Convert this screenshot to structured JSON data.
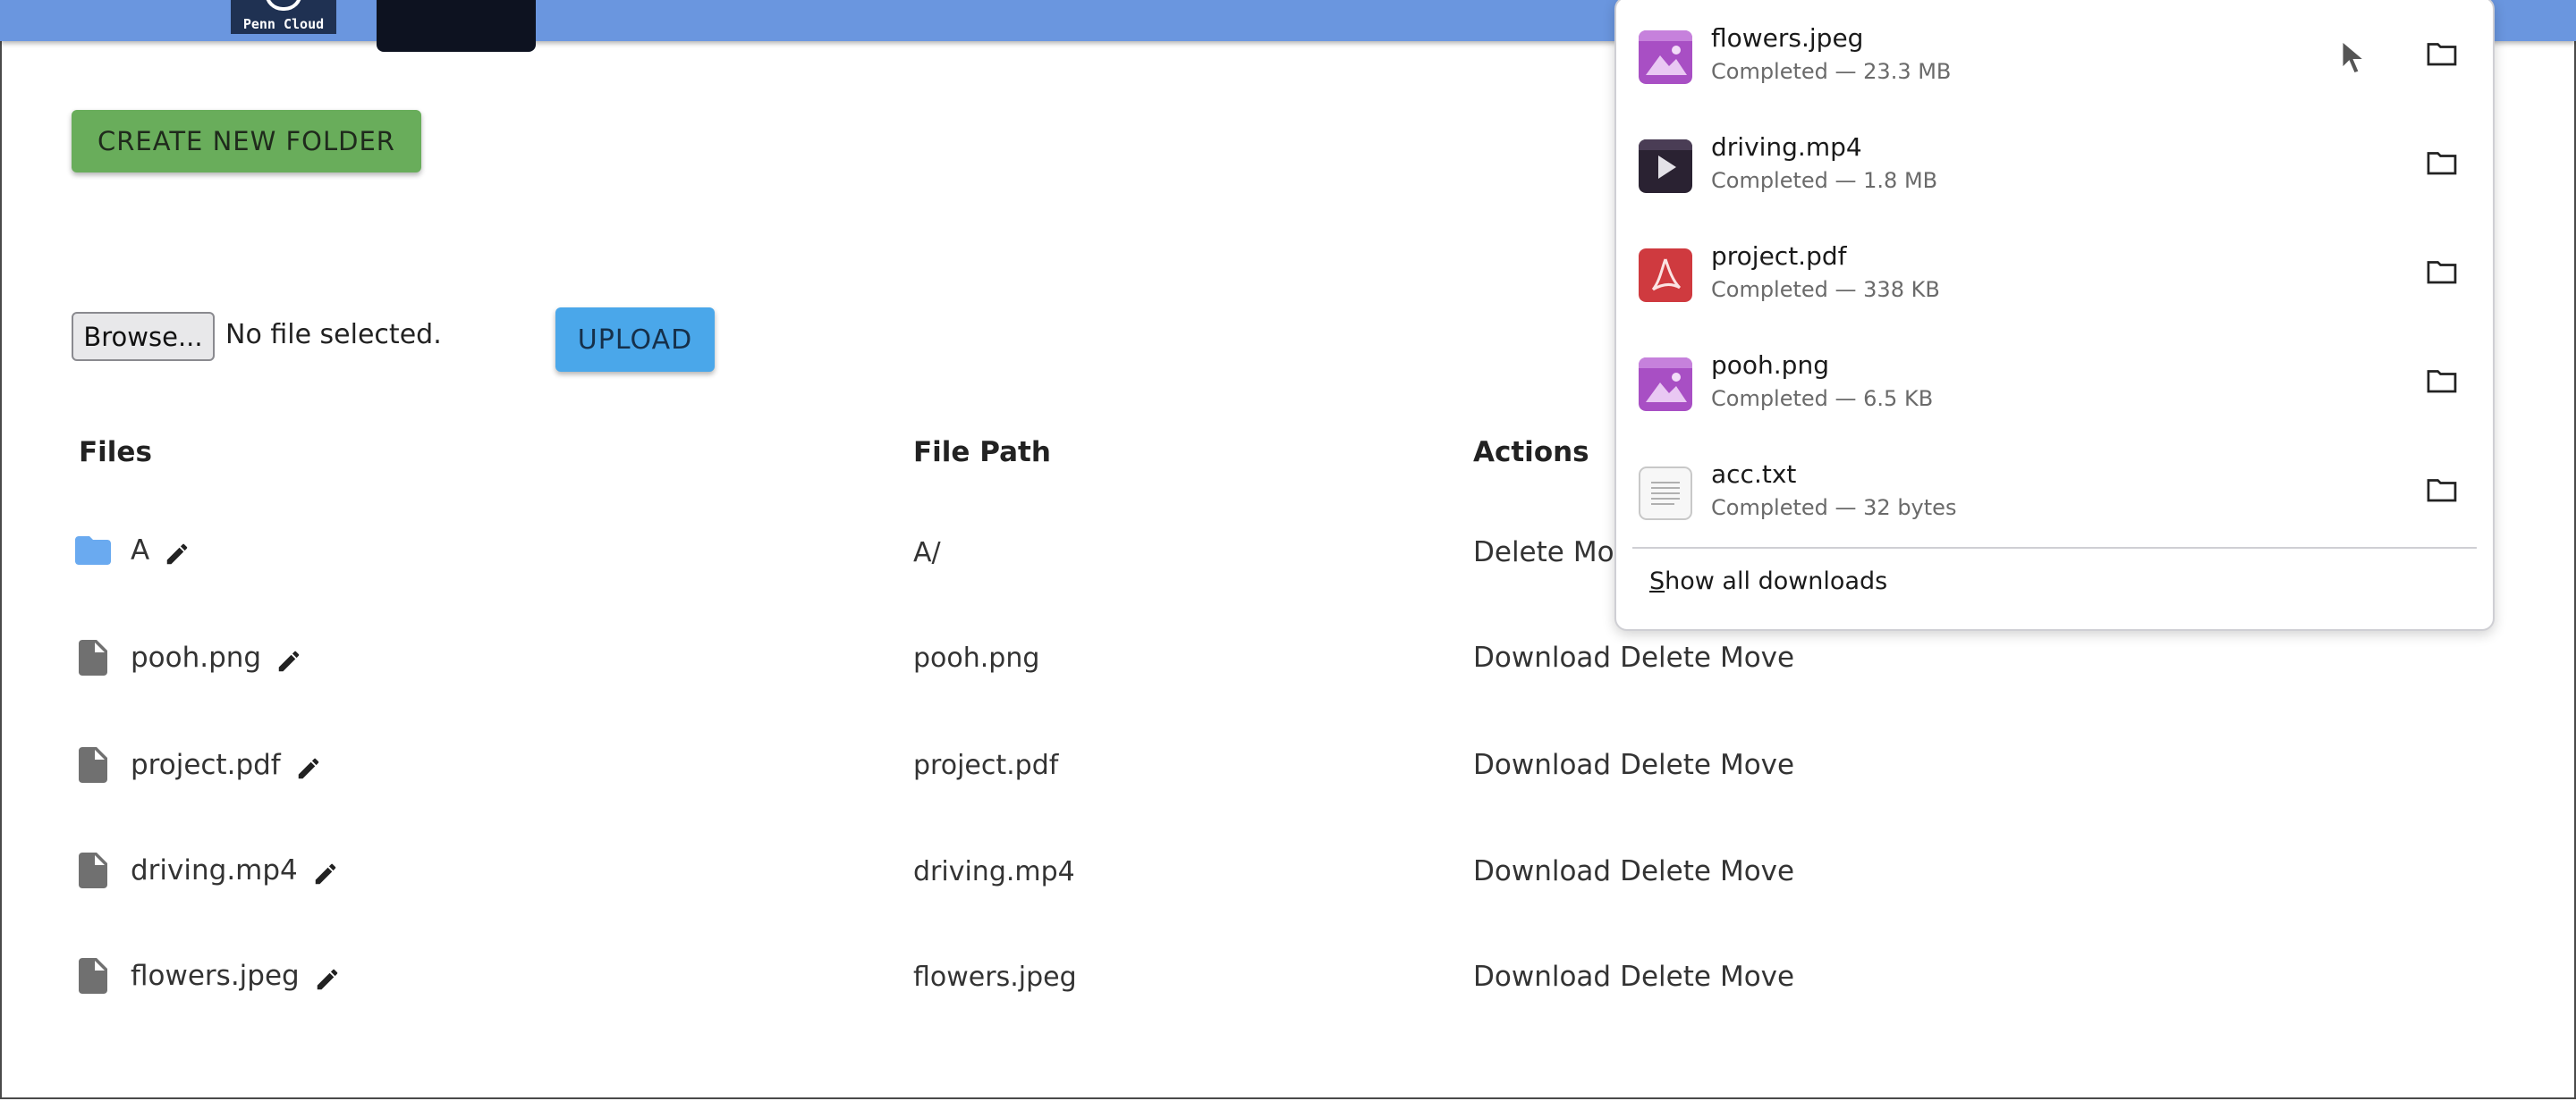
{
  "header": {
    "logo_text": "Penn Cloud"
  },
  "toolbar": {
    "create_folder_label": "CREATE NEW FOLDER",
    "browse_label": "Browse...",
    "no_file_text": "No file selected.",
    "upload_label": "UPLOAD"
  },
  "table": {
    "columns": [
      "Files",
      "File Path",
      "Actions"
    ],
    "rows": [
      {
        "name": "A",
        "path": "A/",
        "type": "folder",
        "actions": [
          "Delete",
          "Move"
        ]
      },
      {
        "name": "pooh.png",
        "path": "pooh.png",
        "type": "file",
        "actions": [
          "Download",
          "Delete",
          "Move"
        ]
      },
      {
        "name": "project.pdf",
        "path": "project.pdf",
        "type": "file",
        "actions": [
          "Download",
          "Delete",
          "Move"
        ]
      },
      {
        "name": "driving.mp4",
        "path": "driving.mp4",
        "type": "file",
        "actions": [
          "Download",
          "Delete",
          "Move"
        ]
      },
      {
        "name": "flowers.jpeg",
        "path": "flowers.jpeg",
        "type": "file",
        "actions": [
          "Download",
          "Delete",
          "Move"
        ]
      }
    ]
  },
  "downloads": {
    "items": [
      {
        "name": "flowers.jpeg",
        "status": "Completed — 23.3 MB",
        "icon": "image-file-icon"
      },
      {
        "name": "driving.mp4",
        "status": "Completed — 1.8 MB",
        "icon": "video-file-icon"
      },
      {
        "name": "project.pdf",
        "status": "Completed — 338 KB",
        "icon": "pdf-file-icon"
      },
      {
        "name": "pooh.png",
        "status": "Completed — 6.5 KB",
        "icon": "image-file-icon"
      },
      {
        "name": "acc.txt",
        "status": "Completed — 32 bytes",
        "icon": "text-file-icon"
      }
    ],
    "show_all_first": "S",
    "show_all_rest": "how all downloads"
  },
  "colors": {
    "header_blue": "#6a96df",
    "create_green": "#69ad5b",
    "upload_blue": "#4aa7ea",
    "folder_blue": "#6aaaf0",
    "file_gray": "#707070"
  }
}
